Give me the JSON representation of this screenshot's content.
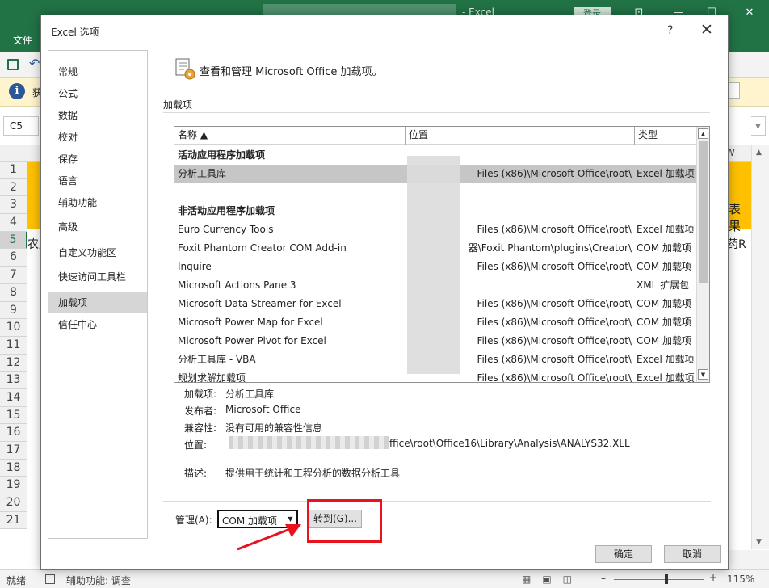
{
  "excel": {
    "title": "-  Excel",
    "login": "登录",
    "file_tab": "文件",
    "cell_ref": "C5",
    "col_w": "W",
    "rows": [
      "1",
      "2",
      "3",
      "4",
      "5",
      "6",
      "7",
      "8",
      "9",
      "10",
      "11",
      "12",
      "13",
      "14",
      "15",
      "16",
      "17",
      "18",
      "19",
      "20",
      "21"
    ],
    "row5_left": "农度",
    "row5_right": "药R",
    "cell_right_text": "表果",
    "status_ready": "就绪",
    "status_accessibility": "辅助功能: 调查",
    "zoom": "115%",
    "accent": "#217346"
  },
  "dialog": {
    "title": "Excel 选项",
    "help": "?",
    "close": "✕",
    "nav": [
      "常规",
      "公式",
      "数据",
      "校对",
      "保存",
      "语言",
      "辅助功能",
      "高级",
      "自定义功能区",
      "快速访问工具栏",
      "加载项",
      "信任中心"
    ],
    "nav_selected": "加载项",
    "header": "查看和管理 Microsoft Office 加载项。",
    "section": "加载项",
    "table": {
      "columns": [
        "名称 ▲",
        "位置",
        "类型"
      ],
      "active_group": "活动应用程序加载项",
      "inactive_group": "非活动应用程序加载项",
      "active_rows": [
        {
          "name": "分析工具库",
          "location": "Files (x86)\\Microsoft Office\\root\\",
          "type": "Excel 加载项"
        }
      ],
      "inactive_rows": [
        {
          "name": "Euro Currency Tools",
          "location": "Files (x86)\\Microsoft Office\\root\\",
          "type": "Excel 加载项"
        },
        {
          "name": "Foxit Phantom Creator COM Add-in",
          "location": "器\\Foxit Phantom\\plugins\\Creator\\",
          "type": "COM 加载项"
        },
        {
          "name": "Inquire",
          "location": "Files (x86)\\Microsoft Office\\root\\",
          "type": "COM 加载项"
        },
        {
          "name": "Microsoft Actions Pane 3",
          "location": "",
          "type": "XML 扩展包"
        },
        {
          "name": "Microsoft Data Streamer for Excel",
          "location": "Files (x86)\\Microsoft Office\\root\\",
          "type": "COM 加载项"
        },
        {
          "name": "Microsoft Power Map for Excel",
          "location": "Files (x86)\\Microsoft Office\\root\\",
          "type": "COM 加载项"
        },
        {
          "name": "Microsoft Power Pivot for Excel",
          "location": "Files (x86)\\Microsoft Office\\root\\",
          "type": "COM 加载项"
        },
        {
          "name": "分析工具库 - VBA",
          "location": "Files (x86)\\Microsoft Office\\root\\",
          "type": "Excel 加载项"
        },
        {
          "name": "规划求解加载项",
          "location": "Files (x86)\\Microsoft Office\\root\\",
          "type": "Excel 加载项"
        }
      ]
    },
    "details": {
      "addin_label": "加载项:",
      "addin_value": "分析工具库",
      "publisher_label": "发布者:",
      "publisher_value": "Microsoft Office",
      "compat_label": "兼容性:",
      "compat_value": "没有可用的兼容性信息",
      "location_label": "位置:",
      "location_value": "ffice\\root\\Office16\\Library\\Analysis\\ANALYS32.XLL",
      "desc_label": "描述:",
      "desc_value": "提供用于统计和工程分析的数据分析工具"
    },
    "manage_label": "管理(A):",
    "manage_value": "COM 加载项",
    "go_label": "转到(G)...",
    "ok_label": "确定",
    "cancel_label": "取消",
    "highlight_color": "#e8131d"
  }
}
